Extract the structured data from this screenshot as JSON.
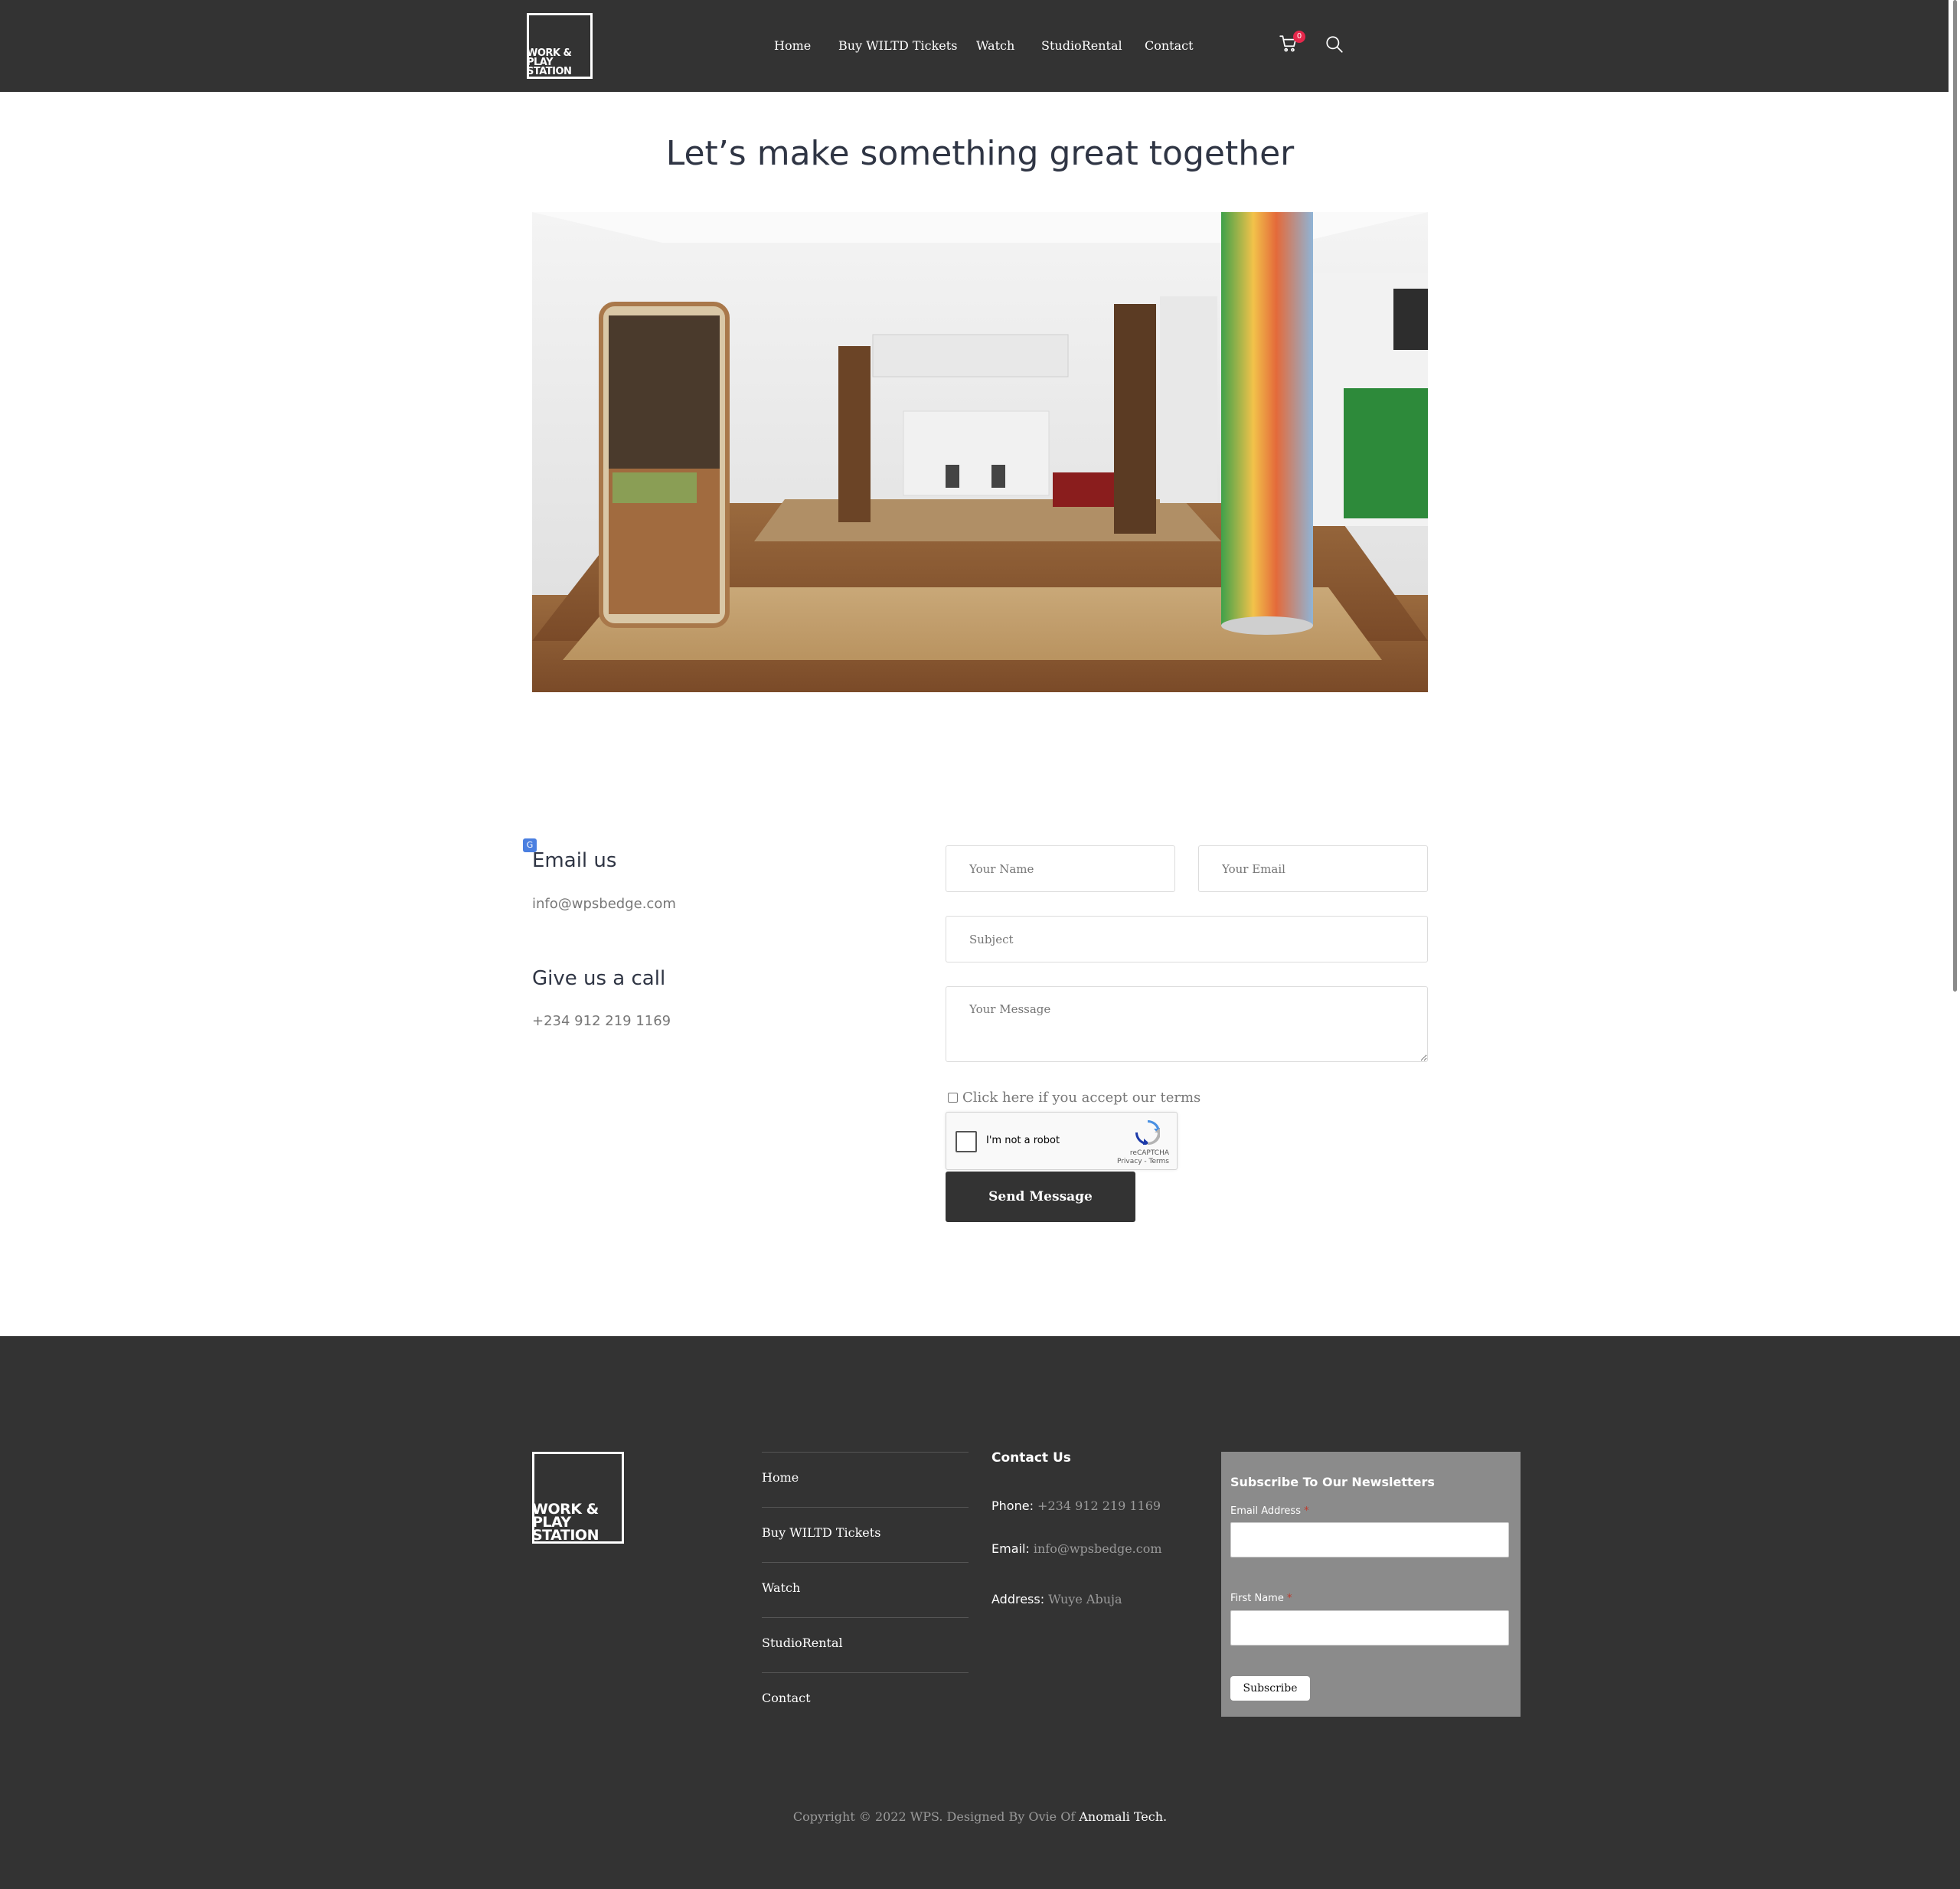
{
  "brand": {
    "logo_lines": [
      "WORK &",
      "PLAY",
      "STATION"
    ]
  },
  "nav": {
    "items": [
      {
        "label": "Home"
      },
      {
        "label": "Buy WILTD Tickets"
      },
      {
        "label": "Watch"
      },
      {
        "label": "StudioRental"
      },
      {
        "label": "Contact"
      }
    ],
    "cart_count": "0"
  },
  "main": {
    "title": "Let’s make something great together",
    "email_heading": "Email us",
    "email": "info@wpsbedge.com",
    "call_heading": "Give us a call",
    "phone": "+234 912 219 1169"
  },
  "form": {
    "name_placeholder": "Your Name",
    "email_placeholder": "Your Email",
    "subject_placeholder": "Subject",
    "message_placeholder": "Your Message",
    "terms_label": "Click here if you accept our terms",
    "recaptcha_label": "I'm not a robot",
    "recaptcha_brand": "reCAPTCHA",
    "recaptcha_links": "Privacy - Terms",
    "submit_label": "Send Message"
  },
  "footer": {
    "links": [
      {
        "label": "Home"
      },
      {
        "label": "Buy WILTD Tickets"
      },
      {
        "label": "Watch"
      },
      {
        "label": "StudioRental"
      },
      {
        "label": "Contact"
      }
    ],
    "contact": {
      "heading": "Contact Us",
      "phone_label": "Phone:",
      "phone": "+234 912 219 1169",
      "email_label": "Email:",
      "email": "info@wpsbedge.com",
      "address_label": "Address:",
      "address": "Wuye Abuja"
    },
    "newsletter": {
      "title": "Subscribe To Our Newsletters",
      "email_label": "Email Address",
      "first_name_label": "First Name",
      "required_mark": "*",
      "subscribe_label": "Subscribe"
    },
    "copyright_prefix": "Copyright © 2022 WPS. Designed By Ovie Of",
    "copyright_company": "Anomali Tech."
  },
  "colors": {
    "header_bg": "#333333",
    "footer_bg": "#333333",
    "badge": "#e6274b",
    "heading": "#2f3544",
    "newsletter_bg": "#8b8b8b"
  },
  "icons": [
    "cart-icon",
    "search-icon",
    "translate-icon",
    "recaptcha-icon"
  ]
}
